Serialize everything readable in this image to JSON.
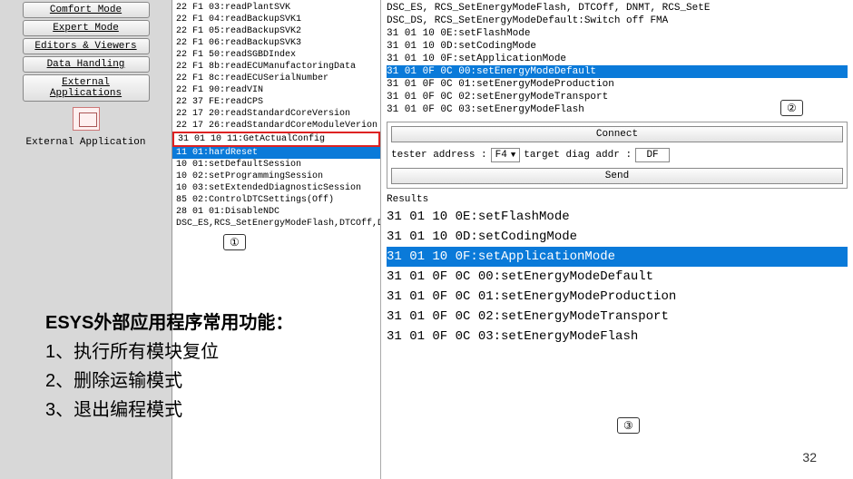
{
  "sidebar": {
    "items": [
      "Comfort Mode",
      "Expert Mode",
      "Editors & Viewers",
      "Data Handling",
      "External Applications"
    ],
    "icon_label": "External Application"
  },
  "mid_list": {
    "lines": [
      "22 F1 03:readPlantSVK",
      "22 F1 04:readBackupSVK1",
      "22 F1 05:readBackupSVK2",
      "22 F1 06:readBackupSVK3",
      "22 F1 50:readSGBDIndex",
      "22 F1 8b:readECUManufactoringData",
      "22 F1 8c:readECUSerialNumber",
      "22 F1 90:readVIN",
      "22 37 FE:readCPS",
      "22 17 20:readStandardCoreVersion",
      "22 17 26:readStandardCoreModuleVerion",
      "31 01 10 11:GetActualConfig",
      "11 01:hardReset",
      "10 01:setDefaultSession",
      "10 02:setProgrammingSession",
      "10 03:setExtendedDiagnosticSession",
      "85 02:ControlDTCSettings(Off)",
      "28 01 01:DisableNDC",
      "DSC_ES,RCS_SetEnergyModeFlash,DTCOff,DNMT,RCS SetE"
    ],
    "boxed_index": 11,
    "selected_index": 12
  },
  "right_top": {
    "lines": [
      "DSC_ES, RCS_SetEnergyModeFlash, DTCOff, DNMT, RCS_SetE",
      "DSC_DS, RCS_SetEnergyModeDefault:Switch off FMA",
      "31 01 10 0E:setFlashMode",
      "31 01 10 0D:setCodingMode",
      "31 01 10 0F:setApplicationMode",
      "31 01 0F 0C 00:setEnergyModeDefault",
      "31 01 0F 0C 01:setEnergyModeProduction",
      "31 01 0F 0C 02:setEnergyModeTransport",
      "31 01 0F 0C 03:setEnergyModeFlash"
    ],
    "selected_index": 5
  },
  "connect_panel": {
    "connect": "Connect",
    "tester_label": "tester address :",
    "tester_value": "F4",
    "target_label": "target diag addr :",
    "target_value": "DF",
    "send": "Send",
    "results_label": "Results"
  },
  "big_list": {
    "lines": [
      "31 01 10 0E:setFlashMode",
      "31 01 10 0D:setCodingMode",
      "31 01 10 0F:setApplicationMode",
      "31 01 0F 0C 00:setEnergyModeDefault",
      "31 01 0F 0C 01:setEnergyModeProduction",
      "31 01 0F 0C 02:setEnergyModeTransport",
      "31 01 0F 0C 03:setEnergyModeFlash"
    ],
    "selected_index": 2
  },
  "callouts": {
    "c1": "①",
    "c2": "②",
    "c3": "③"
  },
  "bottom": {
    "title": "ESYS外部应用程序常用功能：",
    "l1": "1、执行所有模块复位",
    "l2": "2、删除运输模式",
    "l3": "3、退出编程模式"
  },
  "page": "32"
}
